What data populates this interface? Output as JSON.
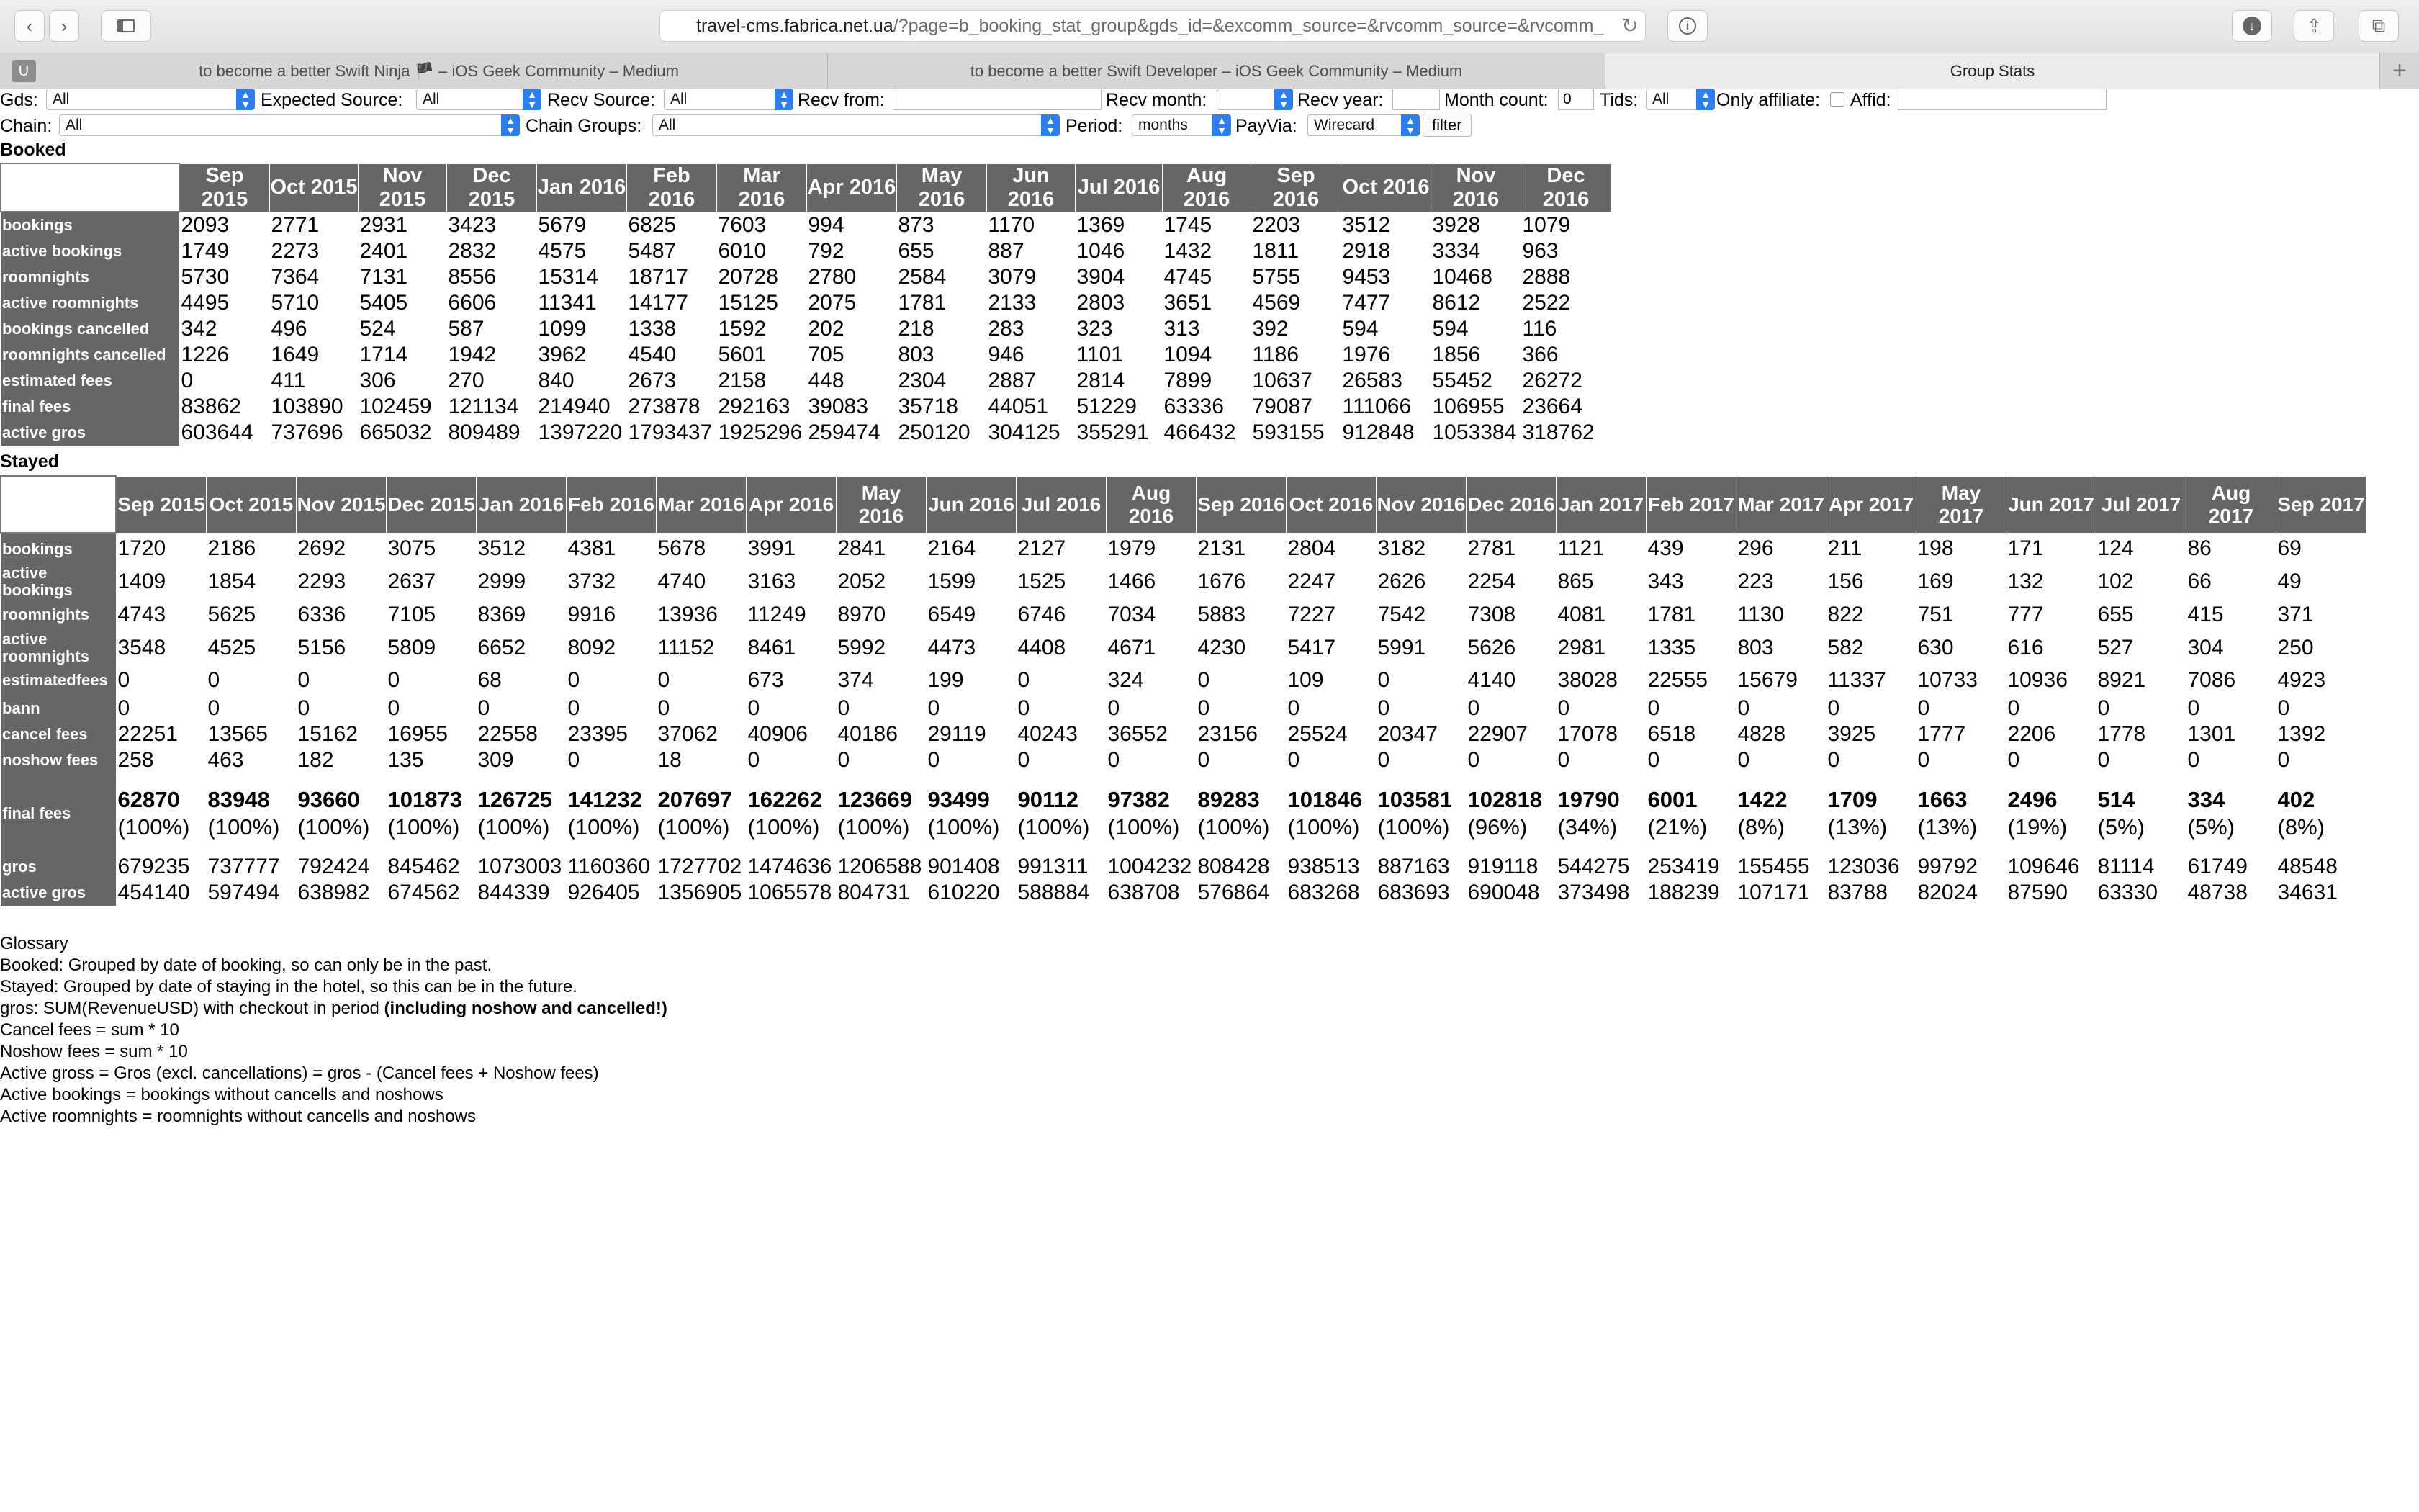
{
  "browser": {
    "url_host": "travel-cms.fabrica.net.ua",
    "url_rest": "/?page=b_booking_stat_group&gds_id=&excomm_source=&rvcomm_source=&rvcomm_",
    "tabs": [
      "to become a better Swift Ninja 🏴 – iOS Geek Community – Medium",
      "to become a better Swift Developer – iOS Geek Community – Medium",
      "Group Stats"
    ],
    "tab_icon_letter": "U"
  },
  "filters": {
    "gds_label": "Gds:",
    "gds_value": "All",
    "expected_source_label": "Expected Source:",
    "expected_source_value": "All",
    "recv_source_label": "Recv Source:",
    "recv_source_value": "All",
    "recv_from_label": "Recv from:",
    "recv_from_value": "",
    "recv_month_label": "Recv month:",
    "recv_month_value": "",
    "recv_year_label": "Recv year:",
    "recv_year_value": "",
    "month_count_label": "Month count:",
    "month_count_value": "0",
    "tids_label": "Tids:",
    "tids_value": "All",
    "only_affiliate_label": "Only affiliate:",
    "affid_label": "Affid:",
    "affid_value": "",
    "chain_label": "Chain:",
    "chain_value": "All",
    "chain_groups_label": "Chain Groups:",
    "chain_groups_value": "All",
    "period_label": "Period:",
    "period_value": "months",
    "payvia_label": "PayVia:",
    "payvia_value": "Wirecard",
    "filter_button": "filter"
  },
  "booked": {
    "title": "Booked",
    "months": [
      "Sep 2015",
      "Oct 2015",
      "Nov 2015",
      "Dec 2015",
      "Jan 2016",
      "Feb 2016",
      "Mar 2016",
      "Apr 2016",
      "May 2016",
      "Jun 2016",
      "Jul 2016",
      "Aug 2016",
      "Sep 2016",
      "Oct 2016",
      "Nov 2016",
      "Dec 2016"
    ],
    "rows": [
      {
        "label": "bookings",
        "values": [
          "2093",
          "2771",
          "2931",
          "3423",
          "5679",
          "6825",
          "7603",
          "994",
          "873",
          "1170",
          "1369",
          "1745",
          "2203",
          "3512",
          "3928",
          "1079"
        ]
      },
      {
        "label": "active bookings",
        "values": [
          "1749",
          "2273",
          "2401",
          "2832",
          "4575",
          "5487",
          "6010",
          "792",
          "655",
          "887",
          "1046",
          "1432",
          "1811",
          "2918",
          "3334",
          "963"
        ]
      },
      {
        "label": "roomnights",
        "values": [
          "5730",
          "7364",
          "7131",
          "8556",
          "15314",
          "18717",
          "20728",
          "2780",
          "2584",
          "3079",
          "3904",
          "4745",
          "5755",
          "9453",
          "10468",
          "2888"
        ]
      },
      {
        "label": "active roomnights",
        "values": [
          "4495",
          "5710",
          "5405",
          "6606",
          "11341",
          "14177",
          "15125",
          "2075",
          "1781",
          "2133",
          "2803",
          "3651",
          "4569",
          "7477",
          "8612",
          "2522"
        ]
      },
      {
        "label": "bookings cancelled",
        "values": [
          "342",
          "496",
          "524",
          "587",
          "1099",
          "1338",
          "1592",
          "202",
          "218",
          "283",
          "323",
          "313",
          "392",
          "594",
          "594",
          "116"
        ]
      },
      {
        "label": "roomnights cancelled",
        "values": [
          "1226",
          "1649",
          "1714",
          "1942",
          "3962",
          "4540",
          "5601",
          "705",
          "803",
          "946",
          "1101",
          "1094",
          "1186",
          "1976",
          "1856",
          "366"
        ]
      },
      {
        "label": "estimated fees",
        "values": [
          "0",
          "411",
          "306",
          "270",
          "840",
          "2673",
          "2158",
          "448",
          "2304",
          "2887",
          "2814",
          "7899",
          "10637",
          "26583",
          "55452",
          "26272"
        ]
      },
      {
        "label": "final fees",
        "values": [
          "83862",
          "103890",
          "102459",
          "121134",
          "214940",
          "273878",
          "292163",
          "39083",
          "35718",
          "44051",
          "51229",
          "63336",
          "79087",
          "111066",
          "106955",
          "23664"
        ]
      },
      {
        "label": "active gros",
        "values": [
          "603644",
          "737696",
          "665032",
          "809489",
          "1397220",
          "1793437",
          "1925296",
          "259474",
          "250120",
          "304125",
          "355291",
          "466432",
          "593155",
          "912848",
          "1053384",
          "318762"
        ]
      }
    ]
  },
  "stayed": {
    "title": "Stayed",
    "months": [
      "Sep 2015",
      "Oct 2015",
      "Nov 2015",
      "Dec 2015",
      "Jan 2016",
      "Feb 2016",
      "Mar 2016",
      "Apr 2016",
      "May 2016",
      "Jun 2016",
      "Jul 2016",
      "Aug 2016",
      "Sep 2016",
      "Oct 2016",
      "Nov 2016",
      "Dec 2016",
      "Jan 2017",
      "Feb 2017",
      "Mar 2017",
      "Apr 2017",
      "May 2017",
      "Jun 2017",
      "Jul 2017",
      "Aug 2017",
      "Sep 2017"
    ],
    "rows": [
      {
        "label": "bookings",
        "values": [
          "1720",
          "2186",
          "2692",
          "3075",
          "3512",
          "4381",
          "5678",
          "3991",
          "2841",
          "2164",
          "2127",
          "1979",
          "2131",
          "2804",
          "3182",
          "2781",
          "1121",
          "439",
          "296",
          "211",
          "198",
          "171",
          "124",
          "86",
          "69"
        ]
      },
      {
        "label": "active bookings",
        "values": [
          "1409",
          "1854",
          "2293",
          "2637",
          "2999",
          "3732",
          "4740",
          "3163",
          "2052",
          "1599",
          "1525",
          "1466",
          "1676",
          "2247",
          "2626",
          "2254",
          "865",
          "343",
          "223",
          "156",
          "169",
          "132",
          "102",
          "66",
          "49"
        ]
      },
      {
        "label": "roomnights",
        "values": [
          "4743",
          "5625",
          "6336",
          "7105",
          "8369",
          "9916",
          "13936",
          "11249",
          "8970",
          "6549",
          "6746",
          "7034",
          "5883",
          "7227",
          "7542",
          "7308",
          "4081",
          "1781",
          "1130",
          "822",
          "751",
          "777",
          "655",
          "415",
          "371"
        ]
      },
      {
        "label": "active roomnights",
        "values": [
          "3548",
          "4525",
          "5156",
          "5809",
          "6652",
          "8092",
          "11152",
          "8461",
          "5992",
          "4473",
          "4408",
          "4671",
          "4230",
          "5417",
          "5991",
          "5626",
          "2981",
          "1335",
          "803",
          "582",
          "630",
          "616",
          "527",
          "304",
          "250"
        ]
      },
      {
        "label": "estimatedfees",
        "values": [
          "0",
          "0",
          "0",
          "0",
          "68",
          "0",
          "0",
          "673",
          "374",
          "199",
          "0",
          "324",
          "0",
          "109",
          "0",
          "4140",
          "38028",
          "22555",
          "15679",
          "11337",
          "10733",
          "10936",
          "8921",
          "7086",
          "4923"
        ]
      },
      {
        "label": "bann",
        "values": [
          "0",
          "0",
          "0",
          "0",
          "0",
          "0",
          "0",
          "0",
          "0",
          "0",
          "0",
          "0",
          "0",
          "0",
          "0",
          "0",
          "0",
          "0",
          "0",
          "0",
          "0",
          "0",
          "0",
          "0",
          "0"
        ]
      },
      {
        "label": "cancel fees",
        "values": [
          "22251",
          "13565",
          "15162",
          "16955",
          "22558",
          "23395",
          "37062",
          "40906",
          "40186",
          "29119",
          "40243",
          "36552",
          "23156",
          "25524",
          "20347",
          "22907",
          "17078",
          "6518",
          "4828",
          "3925",
          "1777",
          "2206",
          "1778",
          "1301",
          "1392"
        ]
      },
      {
        "label": "noshow fees",
        "values": [
          "258",
          "463",
          "182",
          "135",
          "309",
          "0",
          "18",
          "0",
          "0",
          "0",
          "0",
          "0",
          "0",
          "0",
          "0",
          "0",
          "0",
          "0",
          "0",
          "0",
          "0",
          "0",
          "0",
          "0",
          "0"
        ]
      }
    ],
    "final_fees": {
      "label": "final fees",
      "values": [
        "62870",
        "83948",
        "93660",
        "101873",
        "126725",
        "141232",
        "207697",
        "162262",
        "123669",
        "93499",
        "90112",
        "97382",
        "89283",
        "101846",
        "103581",
        "102818",
        "19790",
        "6001",
        "1422",
        "1709",
        "1663",
        "2496",
        "514",
        "334",
        "402"
      ],
      "percents": [
        "(100%)",
        "(100%)",
        "(100%)",
        "(100%)",
        "(100%)",
        "(100%)",
        "(100%)",
        "(100%)",
        "(100%)",
        "(100%)",
        "(100%)",
        "(100%)",
        "(100%)",
        "(100%)",
        "(100%)",
        "(96%)",
        "(34%)",
        "(21%)",
        "(8%)",
        "(13%)",
        "(13%)",
        "(19%)",
        "(5%)",
        "(5%)",
        "(8%)"
      ]
    },
    "tail_rows": [
      {
        "label": "gros",
        "values": [
          "679235",
          "737777",
          "792424",
          "845462",
          "1073003",
          "1160360",
          "1727702",
          "1474636",
          "1206588",
          "901408",
          "991311",
          "1004232",
          "808428",
          "938513",
          "887163",
          "919118",
          "544275",
          "253419",
          "155455",
          "123036",
          "99792",
          "109646",
          "81114",
          "61749",
          "48548"
        ]
      },
      {
        "label": "active gros",
        "values": [
          "454140",
          "597494",
          "638982",
          "674562",
          "844339",
          "926405",
          "1356905",
          "1065578",
          "804731",
          "610220",
          "588884",
          "638708",
          "576864",
          "683268",
          "683693",
          "690048",
          "373498",
          "188239",
          "107171",
          "83788",
          "82024",
          "87590",
          "63330",
          "48738",
          "34631"
        ]
      }
    ]
  },
  "glossary": {
    "title": "Glossary",
    "lines": [
      "Booked: Grouped by date of booking, so can only be in the past.",
      "Stayed: Grouped by date of staying in the hotel, so this can be in the future."
    ],
    "gros_line": "gros: SUM(RevenueUSD) with checkout in period ",
    "gros_bold": "(including noshow and cancelled!)",
    "lines2": [
      "Cancel fees = sum * 10",
      "Noshow fees = sum * 10",
      "Active gross = Gros (excl. cancellations) = gros - (Cancel fees + Noshow fees)",
      "Active bookings = bookings without cancells and noshows",
      "Active roomnights = roomnights without cancells and noshows"
    ]
  }
}
